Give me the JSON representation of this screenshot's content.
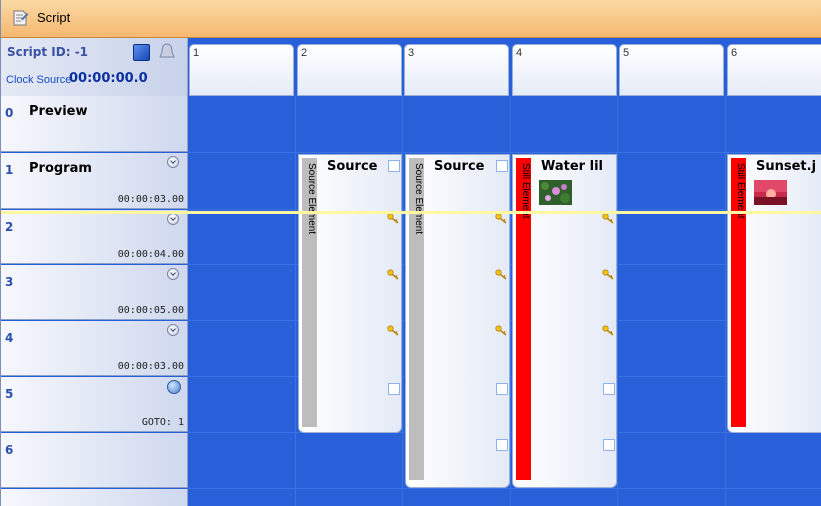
{
  "window": {
    "title": "Script"
  },
  "header": {
    "script_id": "Script ID: -1",
    "clock_label": "Clock Source",
    "clock_value": "00:00:00.0"
  },
  "columns": [
    "1",
    "2",
    "3",
    "4",
    "5",
    "6"
  ],
  "rows": [
    {
      "num": "0",
      "name": "Preview",
      "time": ""
    },
    {
      "num": "1",
      "name": "Program",
      "time": "00:00:03.00"
    },
    {
      "num": "2",
      "name": "",
      "time": "00:00:04.00"
    },
    {
      "num": "3",
      "name": "",
      "time": "00:00:05.00"
    },
    {
      "num": "4",
      "name": "",
      "time": "00:00:03.00"
    },
    {
      "num": "5",
      "name": "",
      "time": "GOTO: 1"
    },
    {
      "num": "6",
      "name": "",
      "time": ""
    }
  ],
  "cards": [
    {
      "column": "2",
      "title": "Source",
      "strip_label": "Source Element",
      "strip_color": "#bdbdbd"
    },
    {
      "column": "3",
      "title": "Source",
      "strip_label": "Source Element",
      "strip_color": "#bdbdbd"
    },
    {
      "column": "4",
      "title": "Water lil",
      "strip_label": "Still Element",
      "strip_color": "#ff0000"
    },
    {
      "column": "6",
      "title": "Sunset.j",
      "strip_label": "Still Element",
      "strip_color": "#ff0000"
    }
  ],
  "colors": {
    "grid": "#2760d8",
    "titlebar": "#f5b870",
    "playhead": "#fff8a0"
  }
}
